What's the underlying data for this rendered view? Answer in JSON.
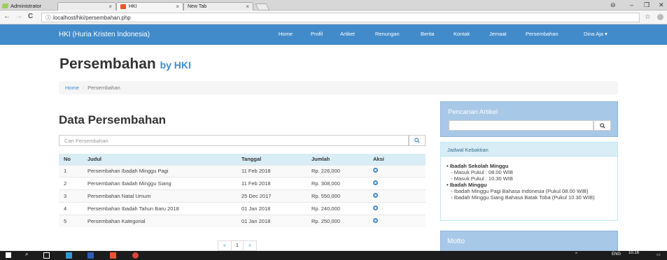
{
  "browser": {
    "profile": "Administrator",
    "tabs": [
      {
        "title": "",
        "active": false
      },
      {
        "title": "HKI",
        "active": true
      },
      {
        "title": "New Tab",
        "active": false
      }
    ],
    "url": "localhost/hki/persembahan.php"
  },
  "navbar": {
    "brand": "HKI (Huria Kristen Indonesia)",
    "items": [
      "Home",
      "Profil",
      "Artikel",
      "Renungan",
      "Berita",
      "Kontak",
      "Jemaat",
      "Persembahan",
      "Dina Aja ▾"
    ]
  },
  "page": {
    "title": "Persembahan",
    "title_small": "by HKI",
    "breadcrumb": [
      "Home",
      "/",
      "Persembahan"
    ]
  },
  "main": {
    "heading": "Data Persembahan",
    "search_placeholder": "Cari Persembahan",
    "columns": [
      "No",
      "Judul",
      "Tanggal",
      "Jumlah",
      "Aksi"
    ],
    "rows": [
      {
        "no": "1",
        "judul": "Persembahan Ibadah Minggu Pagi",
        "tanggal": "11 Feb 2018",
        "jumlah": "Rp. 226,000"
      },
      {
        "no": "2",
        "judul": "Persembahan Ibadah Minggu Siang",
        "tanggal": "11 Feb 2018",
        "jumlah": "Rp. 308,000"
      },
      {
        "no": "3",
        "judul": "Persembahan Natal Umum",
        "tanggal": "25 Dec 2017",
        "jumlah": "Rp. 550,000"
      },
      {
        "no": "4",
        "judul": "Persembahan Ibadah Tahun Baru 2018",
        "tanggal": "01 Jan 2018",
        "jumlah": "Rp. 240,000"
      },
      {
        "no": "5",
        "judul": "Persembahan Kategorial",
        "tanggal": "01 Jan 2018",
        "jumlah": "Rp. 250,000"
      }
    ],
    "pagination": [
      "«",
      "1",
      "»"
    ]
  },
  "sidebar": {
    "search_title": "Pencarian Artikel",
    "jadwal_title": "Jadwal Kebaktian",
    "jadwal": [
      {
        "name": "Ibadah Sekolah Minggu",
        "items": [
          "Masuk Pukul : 08.00 WIB",
          "Masuk Pukul : 10.30 WIB"
        ]
      },
      {
        "name": "Ibadah Minggu",
        "items": [
          "Ibadah Minggu Pagi Bahasa Indonesia (Pukul 08.00 WIB)",
          "Ibadah Minggu Siang Bahasa Batak Toba (Pukul 10.30 WIB)"
        ]
      }
    ],
    "motto_title": "Motto"
  },
  "taskbar": {
    "lang": "ENG",
    "time": "10.16"
  },
  "colors": {
    "primary": "#428bca",
    "table_header": "#d9edf7",
    "panel": "#a8c8e8"
  }
}
